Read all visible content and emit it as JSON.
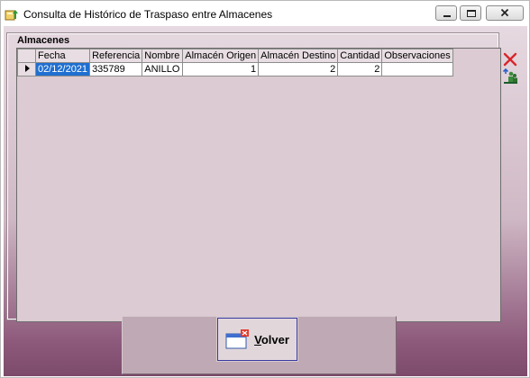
{
  "window": {
    "title": "Consulta de Histórico de Traspaso entre Almacenes"
  },
  "group": {
    "label": "Almacenes"
  },
  "grid": {
    "columns": [
      "Fecha",
      "Referencia",
      "Nombre",
      "Almacén Origen",
      "Almacén Destino",
      "Cantidad",
      "Observaciones"
    ],
    "rows": [
      {
        "fecha": "02/12/2021",
        "referencia": "335789",
        "nombre": "ANILLO",
        "almacen_origen": "1",
        "almacen_destino": "2",
        "cantidad": "2",
        "observaciones": ""
      }
    ]
  },
  "side_icons": [
    "delete-icon",
    "users-icon"
  ],
  "buttons": {
    "volver_first": "V",
    "volver_rest": "olver"
  },
  "colors": {
    "selection": "#1f6fd1",
    "delete": "#d8262b"
  }
}
